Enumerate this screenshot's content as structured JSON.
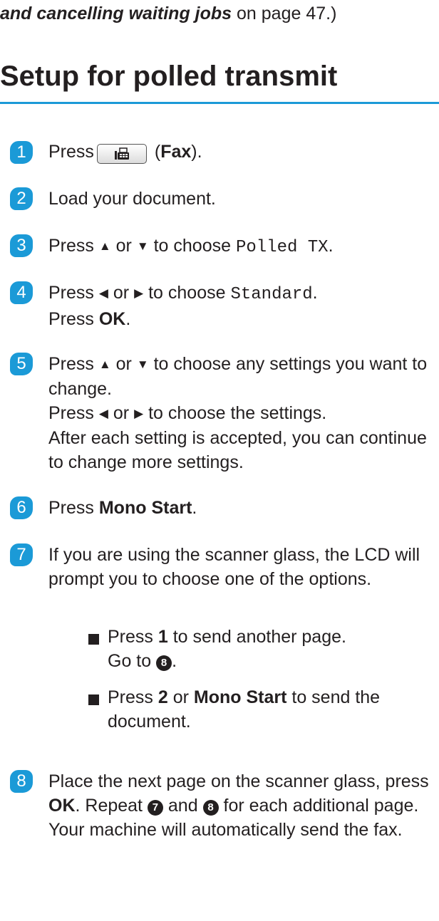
{
  "intro": {
    "italic": "and cancelling waiting jobs",
    "rest": " on page 47.)"
  },
  "section": {
    "title": "Setup for polled transmit"
  },
  "steps": [
    {
      "num": "1",
      "a": "Press",
      "b": " (",
      "bold": "Fax",
      "c": ")."
    },
    {
      "num": "2",
      "text": "Load your document."
    },
    {
      "num": "3",
      "a": "Press ",
      "up": "▲",
      "or": " or ",
      "down": "▼",
      "b": " to choose ",
      "mono": "Polled TX",
      "c": "."
    },
    {
      "num": "4",
      "a": "Press ",
      "left": "◀",
      "or": " or ",
      "right": "▶",
      "b": " to choose ",
      "mono": "Standard",
      "c": ".",
      "line2a": "Press ",
      "line2bold": "OK",
      "line2c": "."
    },
    {
      "num": "5",
      "a": "Press ",
      "up": "▲",
      "or": " or ",
      "down": "▼",
      "b": " to choose any settings you want to change.",
      "line2a": "Press ",
      "left": "◀",
      "or2": " or ",
      "right": "▶",
      "line2b": " to choose the settings.",
      "line3": "After each setting is accepted, you can continue to change more settings."
    },
    {
      "num": "6",
      "a": "Press ",
      "bold": "Mono Start",
      "c": "."
    },
    {
      "num": "7",
      "text": "If you are using the scanner glass, the LCD will prompt you to choose one of the options."
    },
    {
      "num": "8",
      "a": "Place the next page on the scanner glass, press ",
      "bold": "OK",
      "b": ". Repeat ",
      "ref1": "7",
      "and": " and ",
      "ref2": "8",
      "c": " for each additional page.",
      "line2": "Your machine will automatically send the fax."
    }
  ],
  "bullets": [
    {
      "a": "Press ",
      "bold": "1",
      "b": " to send another page.",
      "line2a": "Go to ",
      "ref": "8",
      "line2c": "."
    },
    {
      "a": "Press ",
      "bold": "2",
      "or": " or ",
      "bold2": "Mono Start",
      "b": " to send the document."
    }
  ],
  "icons": {
    "fax": "fax-icon"
  },
  "colors": {
    "accent": "#1b9ad7",
    "text": "#231f20"
  }
}
